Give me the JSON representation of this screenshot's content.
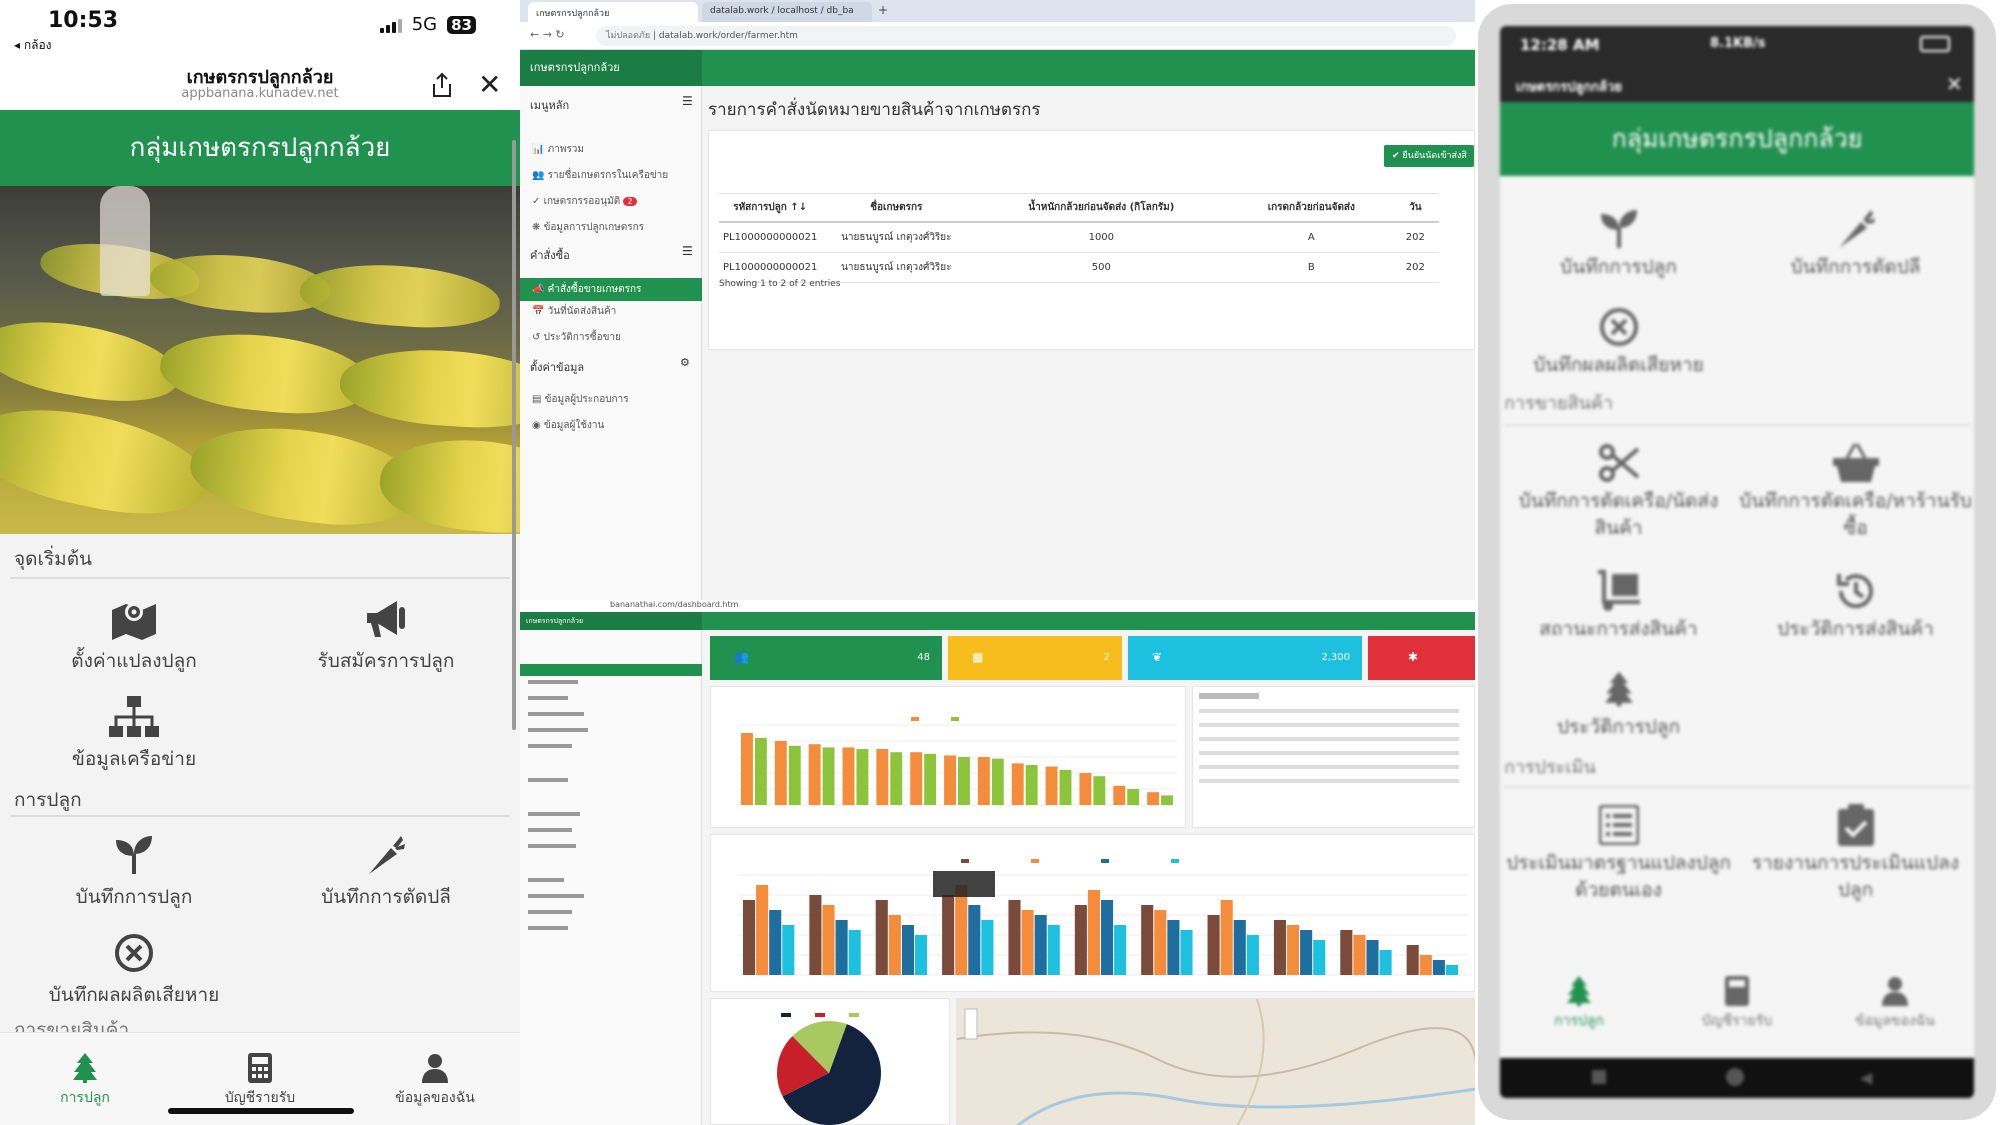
{
  "left_phone": {
    "status": {
      "time": "10:53",
      "back": "◂ กล้อง",
      "network": "5G",
      "battery": "83"
    },
    "header": {
      "title": "เกษตรกรปลูกกล้วย",
      "url": "appbanana.kunadev.net"
    },
    "banner": "กลุ่มเกษตรกรปลูกกล้วย",
    "sections": {
      "start": "จุดเริ่มต้น",
      "planting": "การปลูก",
      "selling": "การขายสินค้า"
    },
    "tiles": {
      "plot": "ตั้งค่าแปลงปลูก",
      "register": "รับสมัครการปลูก",
      "network": "ข้อมูลเครือข่าย",
      "record_planting": "บันทึกการปลูก",
      "record_cutting": "บันทึกการตัดปลี",
      "record_damage": "บันทึกผลผลิตเสียหาย"
    },
    "tabs": {
      "planting": "การปลูก",
      "accounts": "บัญชีรายรับ",
      "profile": "ข้อมูลของฉัน"
    }
  },
  "browser_top": {
    "tabs": [
      "เกษตรกรปลูกกล้วย",
      "datalab.work / localhost / db_ba"
    ],
    "url_security": "ไม่ปลอดภัย",
    "url": "datalab.work/order/farmer.htm",
    "app_title": "เกษตรกรปลูกกล้วย",
    "sidebar": {
      "main_menu": "เมนูหลัก",
      "overview": "ภาพรวม",
      "members": "รายชื่อเกษตรกรในเครือข่าย",
      "pending": "เกษตรกรรออนุมัติ",
      "pending_count": "2",
      "planting_data": "ข้อมูลการปลูกเกษตรกร",
      "orders": "คำสั่งซื้อ",
      "farmer_orders": "คำสั่งซื้อขายเกษตรกร",
      "delivery_date": "วันที่นัดส่งสินค้า",
      "history": "ประวัติการซื้อขาย",
      "settings": "ตั้งค่าข้อมูล",
      "operator": "ข้อมูลผู้ประกอบการ",
      "user": "ข้อมูลผู้ใช้งาน"
    },
    "page_title": "รายการคำสั่งนัดหมายขายสินค้าจากเกษตรกร",
    "confirm_button": "ยืนยันนัดเข้าส่งสิ",
    "table": {
      "headers": [
        "รหัสการปลูก",
        "ชื่อเกษตรกร",
        "น้ำหนักกล้วยก่อนจัดส่ง (กิโลกรัม)",
        "เกรดกล้วยก่อนจัดส่ง",
        "วัน"
      ],
      "rows": [
        [
          "PL1000000000021",
          "นายธนบูรณ์ เกตุวงศ์วิริยะ",
          "1000",
          "A",
          "202"
        ],
        [
          "PL1000000000021",
          "นายธนบูรณ์ เกตุวงศ์วิริยะ",
          "500",
          "B",
          "202"
        ]
      ]
    },
    "showing": "Showing 1 to 2 of 2 entries"
  },
  "browser_bottom": {
    "url": "bananathai.com/dashboard.htm",
    "app_title": "เกษตรกรปลูกกล้วย",
    "kpis": [
      {
        "value": "48",
        "color": "#219150"
      },
      {
        "value": "2",
        "color": "#f7bd1c"
      },
      {
        "value": "2,300",
        "color": "#1ec0e0"
      },
      {
        "value": "",
        "color": "#e0303a"
      }
    ],
    "chart1_colors": [
      "#f58c3c",
      "#8cc43c"
    ],
    "chart1_values": [
      [
        45,
        42
      ],
      [
        40,
        37
      ],
      [
        38,
        36
      ],
      [
        36,
        35
      ],
      [
        35,
        33
      ],
      [
        33,
        32
      ],
      [
        31,
        30
      ],
      [
        30,
        29
      ],
      [
        26,
        25
      ],
      [
        24,
        22
      ],
      [
        20,
        18
      ],
      [
        12,
        10
      ],
      [
        8,
        6
      ]
    ],
    "chart2_colors": [
      "#7a4a3a",
      "#f58c3c",
      "#1e6fa0",
      "#1ec0e0"
    ],
    "chart2_values": [
      [
        30,
        36,
        26,
        20
      ],
      [
        32,
        28,
        22,
        18
      ],
      [
        30,
        24,
        20,
        16
      ],
      [
        32,
        36,
        28,
        22
      ],
      [
        30,
        26,
        24,
        20
      ],
      [
        28,
        34,
        30,
        20
      ],
      [
        28,
        26,
        22,
        18
      ],
      [
        24,
        30,
        22,
        16
      ],
      [
        22,
        20,
        18,
        14
      ],
      [
        18,
        16,
        14,
        10
      ],
      [
        12,
        8,
        6,
        4
      ]
    ],
    "pie": [
      {
        "value": 62,
        "color": "#13223d"
      },
      {
        "value": 20,
        "color": "#c8202a"
      },
      {
        "value": 18,
        "color": "#a8c860"
      }
    ]
  },
  "right_phone": {
    "status": {
      "time": "12:28 AM",
      "net": "8.1KB/s"
    },
    "header": "เกษตรกรปลูกกล้วย",
    "banner": "กลุ่มเกษตรกรปลูกกล้วย",
    "tiles": {
      "record_planting": "บันทึกการปลูก",
      "record_cutting": "บันทึกการตัดปลี",
      "record_damage": "บันทึกผลผลิตเสียหาย",
      "record_cut_delivery": "บันทึกการตัดเครือ/นัดส่งสินค้า",
      "record_cut_shop": "บันทึกการตัดเครือ/หาร้านรับซื้อ",
      "delivery_status": "สถานะการส่งสินค้า",
      "delivery_history": "ประวัติการส่งสินค้า",
      "planting_history": "ประวัติการปลูก",
      "self_assess": "ประเมินมาตรฐานแปลงปลูกด้วยตนเอง",
      "assess_report": "รายงานการประเมินแปลงปลูก"
    },
    "sections": {
      "selling": "การขายสินค้า",
      "assessment": "การประเมิน"
    },
    "tabs": {
      "planting": "การปลูก",
      "accounts": "บัญชีรายรับ",
      "profile": "ข้อมูลของฉัน"
    }
  }
}
